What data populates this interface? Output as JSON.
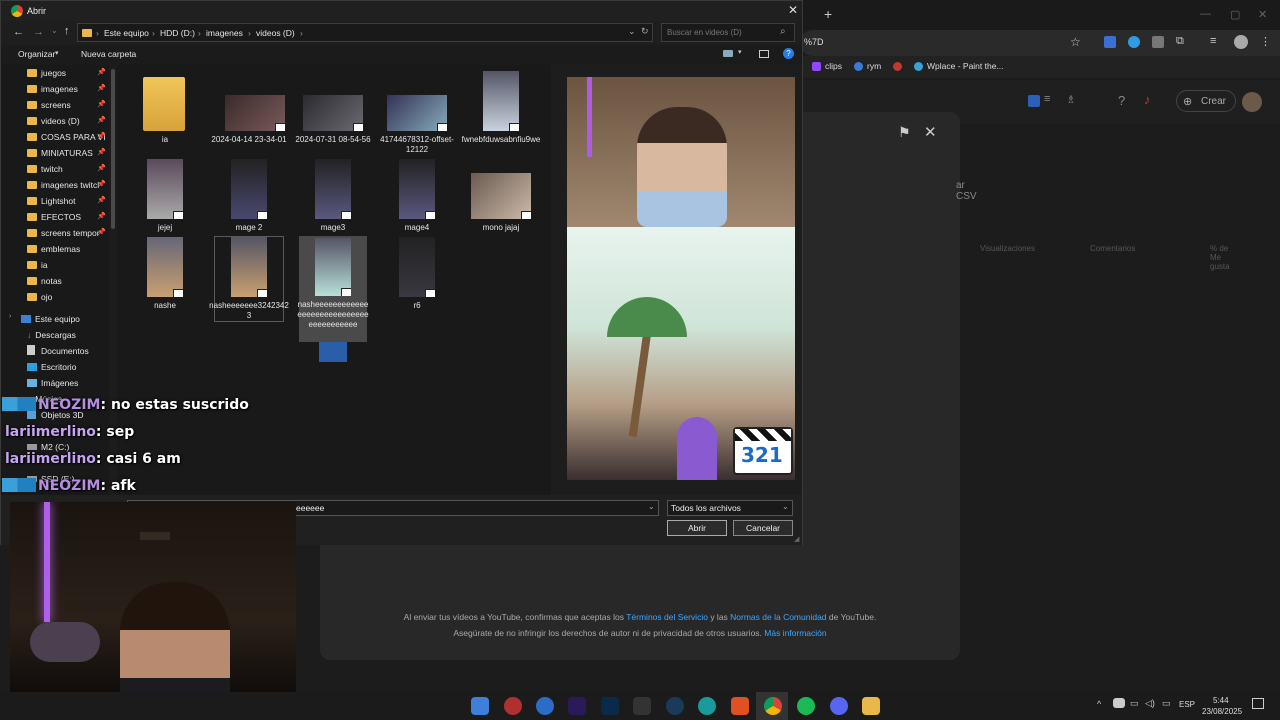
{
  "browser": {
    "tab_new": "+",
    "address_tail": "%7D",
    "bookmarks": [
      "clips",
      "rym",
      "Wplace - Paint the..."
    ],
    "create_label": "Crear",
    "csv_label": "ar CSV",
    "col_views": "Visualizaciones",
    "col_comments": "Comentarios",
    "col_likes": "% de Me gusta",
    "footer_line1_a": "Al enviar tus vídeos a YouTube, confirmas que aceptas los ",
    "footer_link1": "Términos del Servicio",
    "footer_line1_b": " y las ",
    "footer_link2": "Normas de la Comunidad",
    "footer_line1_c": " de YouTube.",
    "footer_line2": "Asegúrate de no infringir los derechos de autor ni de privacidad de otros usuarios. ",
    "footer_link3": "Más información"
  },
  "dialog": {
    "title": "Abrir",
    "breadcrumb": [
      "Este equipo",
      "HDD (D:)",
      "imagenes",
      "videos (D)"
    ],
    "search_placeholder": "Buscar en videos (D)",
    "organize": "Organizar",
    "new_folder": "Nueva carpeta",
    "nav_items": [
      "juegos",
      "imagenes",
      "screens",
      "videos (D)",
      "COSAS PARA VI",
      "MINIATURAS",
      "twitch",
      "imagenes twitcl",
      "Lightshot",
      "EFECTOS",
      "screens tempor",
      "emblemas",
      "ia",
      "notas",
      "ojo"
    ],
    "nav_pc": "Este equipo",
    "nav_pc_items": [
      "Descargas",
      "Documentos",
      "Escritorio",
      "Imágenes",
      "Música",
      "Objetos 3D",
      "M2 (C:)",
      "SSD (E:)"
    ],
    "files": [
      {
        "name": "ia"
      },
      {
        "name": "2024-04-14 23-34-01"
      },
      {
        "name": "2024-07-31 08-54-56"
      },
      {
        "name": "41744678312-offset-12122"
      },
      {
        "name": "fwnebfduwsabnfiu9we"
      },
      {
        "name": "jejej"
      },
      {
        "name": "mage 2"
      },
      {
        "name": "mage3"
      },
      {
        "name": "mage4"
      },
      {
        "name": "mono jajaj"
      },
      {
        "name": "nashe"
      },
      {
        "name": "nasheeeeeee32423423"
      },
      {
        "name": "nasheeeeeeeeeeeeeeeeeeeeeeeeeeeeeeeeeeeeeee"
      },
      {
        "name": "r6"
      }
    ],
    "filename_value": "eeeeee",
    "filter": "Todos los archivos",
    "open_button": "Abrir",
    "cancel_button": "Cancelar"
  },
  "chat": [
    {
      "user": "NEOZIM",
      "msg": ": no estas suscrido"
    },
    {
      "user": "lariimerlino",
      "msg": ": sep"
    },
    {
      "user": "lariimerlino",
      "msg": ": casi 6 am"
    },
    {
      "user": "NEOZIM",
      "msg": ": afk"
    }
  ],
  "preview_badge": "321",
  "taskbar": {
    "lang": "ESP",
    "time": "5:44",
    "date": "23/08/2025"
  },
  "colors": {
    "accent": "#3b82d6",
    "folder": "#e8b84a",
    "link": "#3ea6ff"
  }
}
